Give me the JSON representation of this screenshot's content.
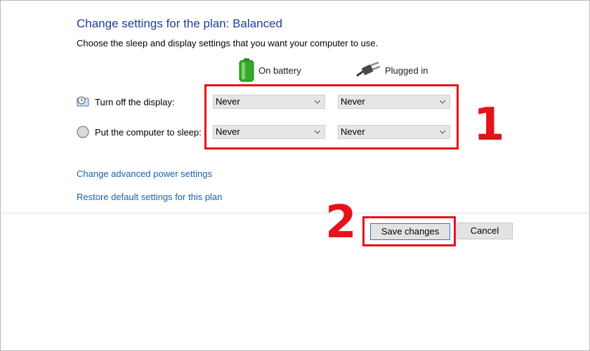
{
  "page": {
    "title": "Change settings for the plan: Balanced",
    "subtitle": "Choose the sleep and display settings that you want your computer to use."
  },
  "columns": {
    "battery": {
      "label": "On battery",
      "icon": "battery-icon"
    },
    "plugged": {
      "label": "Plugged in",
      "icon": "plug-icon"
    }
  },
  "rows": [
    {
      "label": "Turn off the display:",
      "icon": "display-timer-icon",
      "battery_value": "Never",
      "plugged_value": "Never"
    },
    {
      "label": "Put the computer to sleep:",
      "icon": "sleep-moon-icon",
      "battery_value": "Never",
      "plugged_value": "Never"
    }
  ],
  "links": {
    "advanced": "Change advanced power settings",
    "restore": "Restore default settings for this plan"
  },
  "buttons": {
    "save": "Save changes",
    "cancel": "Cancel"
  },
  "annotations": {
    "step1": "1",
    "step2": "2",
    "highlight_color": "#e4121a"
  },
  "colors": {
    "title": "#1e3e9d",
    "link": "#1c5fa8"
  }
}
